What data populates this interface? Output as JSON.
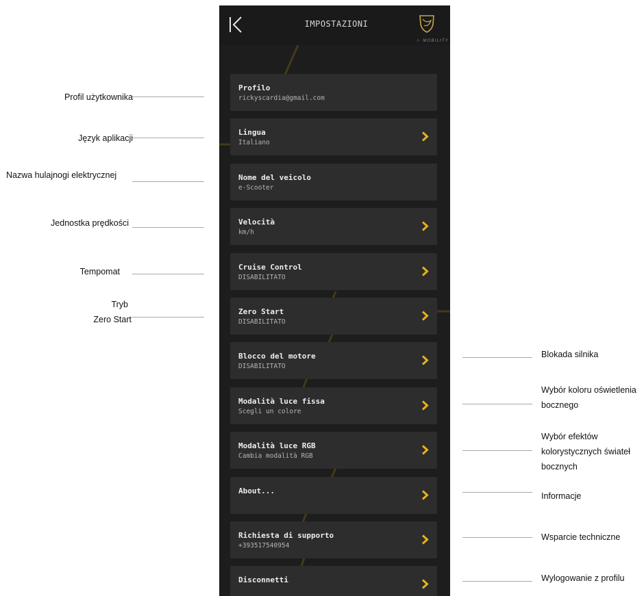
{
  "header": {
    "title": "IMPOSTAZIONI",
    "mobility": "MOBILITY",
    "accent_color": "#e8b21a"
  },
  "settings": [
    {
      "title": "Profilo",
      "subtitle": "rickyscardia@gmail.com",
      "has_chevron": false
    },
    {
      "title": "Lingua",
      "subtitle": "Italiano",
      "has_chevron": true
    },
    {
      "title": "Nome del veicolo",
      "subtitle": "e-Scooter",
      "has_chevron": false
    },
    {
      "title": "Velocità",
      "subtitle": "km/h",
      "has_chevron": true
    },
    {
      "title": "Cruise Control",
      "subtitle": "DISABILITATO",
      "has_chevron": true
    },
    {
      "title": "Zero Start",
      "subtitle": "DISABILITATO",
      "has_chevron": true
    },
    {
      "title": "Blocco del motore",
      "subtitle": "DISABILITATO",
      "has_chevron": true
    },
    {
      "title": "Modalità luce fissa",
      "subtitle": "Scegli un colore",
      "has_chevron": true
    },
    {
      "title": "Modalità luce RGB",
      "subtitle": "Cambia modalità RGB",
      "has_chevron": true
    },
    {
      "title": "About...",
      "subtitle": "",
      "has_chevron": true
    },
    {
      "title": "Richiesta di supporto",
      "subtitle": "+393517540954",
      "has_chevron": true
    },
    {
      "title": "Disconnetti",
      "subtitle": "",
      "has_chevron": true
    }
  ],
  "annotations": {
    "left": [
      "Profil użytkownika",
      "Język aplikacji",
      "Nazwa hulajnogi elektrycznej",
      "Jednostka prędkości",
      "Tempomat",
      "Tryb",
      "Zero Start"
    ],
    "right": [
      "Blokada silnika",
      "Wybór koloru oświetlenia",
      "bocznego",
      "Wybór efektów",
      "kolorystycznych świateł",
      "bocznych",
      "Informacje",
      "Wsparcie techniczne",
      "Wylogowanie z profilu"
    ]
  }
}
